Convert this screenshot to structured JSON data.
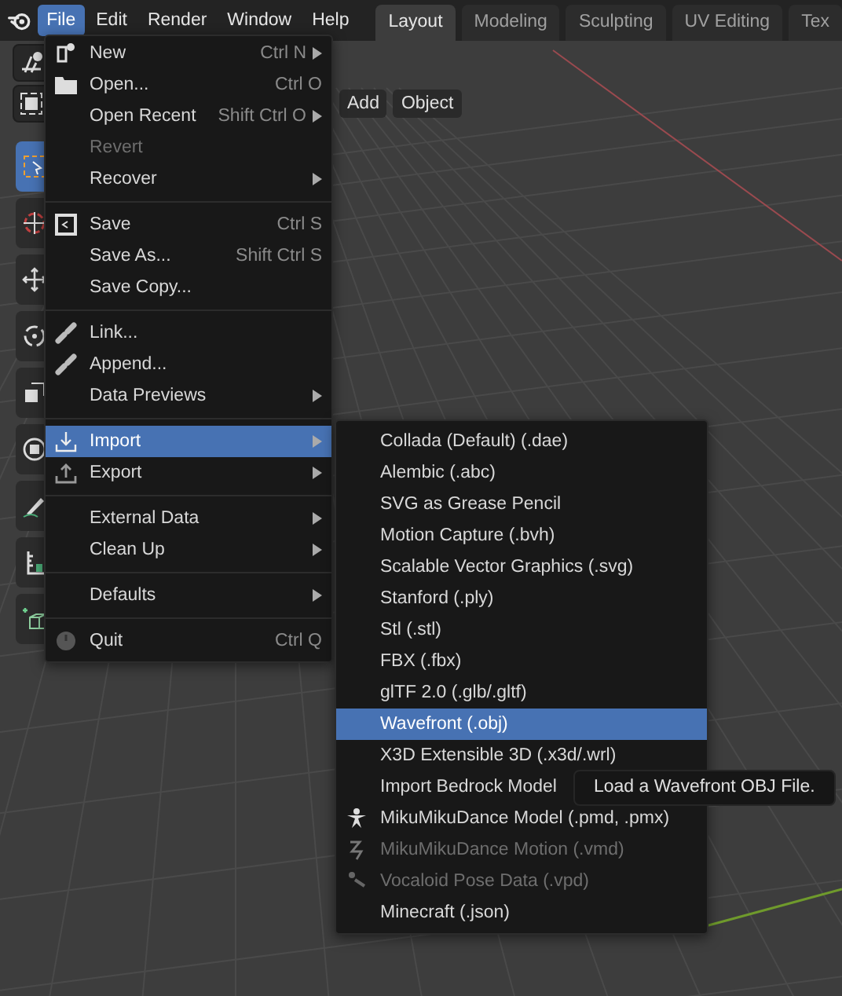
{
  "menubar": [
    {
      "label": "File",
      "selected": true
    },
    {
      "label": "Edit",
      "selected": false
    },
    {
      "label": "Render",
      "selected": false
    },
    {
      "label": "Window",
      "selected": false
    },
    {
      "label": "Help",
      "selected": false
    }
  ],
  "workspace_tabs": [
    {
      "label": "Layout",
      "selected": true
    },
    {
      "label": "Modeling",
      "selected": false
    },
    {
      "label": "Sculpting",
      "selected": false
    },
    {
      "label": "UV Editing",
      "selected": false
    },
    {
      "label": "Tex",
      "selected": false
    }
  ],
  "header_buttons": [
    "Add",
    "Object"
  ],
  "tools": [
    {
      "kind": "select",
      "selected": true
    },
    {
      "kind": "cursor",
      "selected": false
    },
    {
      "kind": "move",
      "selected": false
    },
    {
      "kind": "rotate",
      "selected": false
    },
    {
      "kind": "scale",
      "selected": false
    },
    {
      "kind": "transform",
      "selected": false
    },
    {
      "kind": "annotate",
      "selected": false
    },
    {
      "kind": "measure",
      "selected": false
    },
    {
      "kind": "add-cube",
      "selected": false
    }
  ],
  "file_menu": {
    "groups": [
      [
        {
          "kind": "new",
          "label": "New",
          "shortcut": "Ctrl N",
          "submenu": true,
          "disabled": false,
          "selected": false
        },
        {
          "kind": "open",
          "label": "Open...",
          "shortcut": "Ctrl O",
          "submenu": false,
          "disabled": false,
          "selected": false
        },
        {
          "kind": "plain",
          "label": "Open Recent",
          "shortcut": "Shift Ctrl O",
          "submenu": true,
          "disabled": false,
          "selected": false
        },
        {
          "kind": "plain",
          "label": "Revert",
          "submenu": false,
          "disabled": true,
          "selected": false
        },
        {
          "kind": "plain",
          "label": "Recover",
          "submenu": true,
          "disabled": false,
          "selected": false
        }
      ],
      [
        {
          "kind": "save",
          "label": "Save",
          "shortcut": "Ctrl S",
          "submenu": false,
          "disabled": false,
          "selected": false
        },
        {
          "kind": "plain",
          "label": "Save As...",
          "shortcut": "Shift Ctrl S",
          "submenu": false,
          "disabled": false,
          "selected": false
        },
        {
          "kind": "plain",
          "label": "Save Copy...",
          "submenu": false,
          "disabled": false,
          "selected": false
        }
      ],
      [
        {
          "kind": "link",
          "label": "Link...",
          "submenu": false,
          "disabled": false,
          "selected": false
        },
        {
          "kind": "append",
          "label": "Append...",
          "submenu": false,
          "disabled": false,
          "selected": false
        },
        {
          "kind": "plain",
          "label": "Data Previews",
          "submenu": true,
          "disabled": false,
          "selected": false
        }
      ],
      [
        {
          "kind": "import",
          "label": "Import",
          "submenu": true,
          "disabled": false,
          "selected": true
        },
        {
          "kind": "export",
          "label": "Export",
          "submenu": true,
          "disabled": false,
          "selected": false
        }
      ],
      [
        {
          "kind": "plain",
          "label": "External Data",
          "submenu": true,
          "disabled": false,
          "selected": false
        },
        {
          "kind": "plain",
          "label": "Clean Up",
          "submenu": true,
          "disabled": false,
          "selected": false
        }
      ],
      [
        {
          "kind": "plain",
          "label": "Defaults",
          "submenu": true,
          "disabled": false,
          "selected": false
        }
      ],
      [
        {
          "kind": "quit",
          "label": "Quit",
          "shortcut": "Ctrl Q",
          "submenu": false,
          "disabled": false,
          "selected": false
        }
      ]
    ]
  },
  "import_menu": [
    {
      "kind": "plain",
      "label": "Collada (Default) (.dae)",
      "disabled": false,
      "selected": false
    },
    {
      "kind": "plain",
      "label": "Alembic (.abc)",
      "disabled": false,
      "selected": false
    },
    {
      "kind": "plain",
      "label": "SVG as Grease Pencil",
      "disabled": false,
      "selected": false
    },
    {
      "kind": "plain",
      "label": "Motion Capture (.bvh)",
      "disabled": false,
      "selected": false
    },
    {
      "kind": "plain",
      "label": "Scalable Vector Graphics (.svg)",
      "disabled": false,
      "selected": false
    },
    {
      "kind": "plain",
      "label": "Stanford (.ply)",
      "disabled": false,
      "selected": false
    },
    {
      "kind": "plain",
      "label": "Stl (.stl)",
      "disabled": false,
      "selected": false
    },
    {
      "kind": "plain",
      "label": "FBX (.fbx)",
      "disabled": false,
      "selected": false
    },
    {
      "kind": "plain",
      "label": "glTF 2.0 (.glb/.gltf)",
      "disabled": false,
      "selected": false
    },
    {
      "kind": "plain",
      "label": "Wavefront (.obj)",
      "disabled": false,
      "selected": true
    },
    {
      "kind": "plain",
      "label": "X3D Extensible 3D (.x3d/.wrl)",
      "disabled": false,
      "selected": false
    },
    {
      "kind": "plain",
      "label": "Import Bedrock Model",
      "disabled": false,
      "selected": false
    },
    {
      "kind": "figure",
      "label": "MikuMikuDance Model (.pmd, .pmx)",
      "disabled": false,
      "selected": false
    },
    {
      "kind": "motion",
      "label": "MikuMikuDance Motion (.vmd)",
      "disabled": true,
      "selected": false
    },
    {
      "kind": "pose",
      "label": "Vocaloid Pose Data (.vpd)",
      "disabled": true,
      "selected": false
    },
    {
      "kind": "plain",
      "label": "Minecraft (.json)",
      "disabled": false,
      "selected": false
    }
  ],
  "tooltip": "Load a Wavefront OBJ File."
}
